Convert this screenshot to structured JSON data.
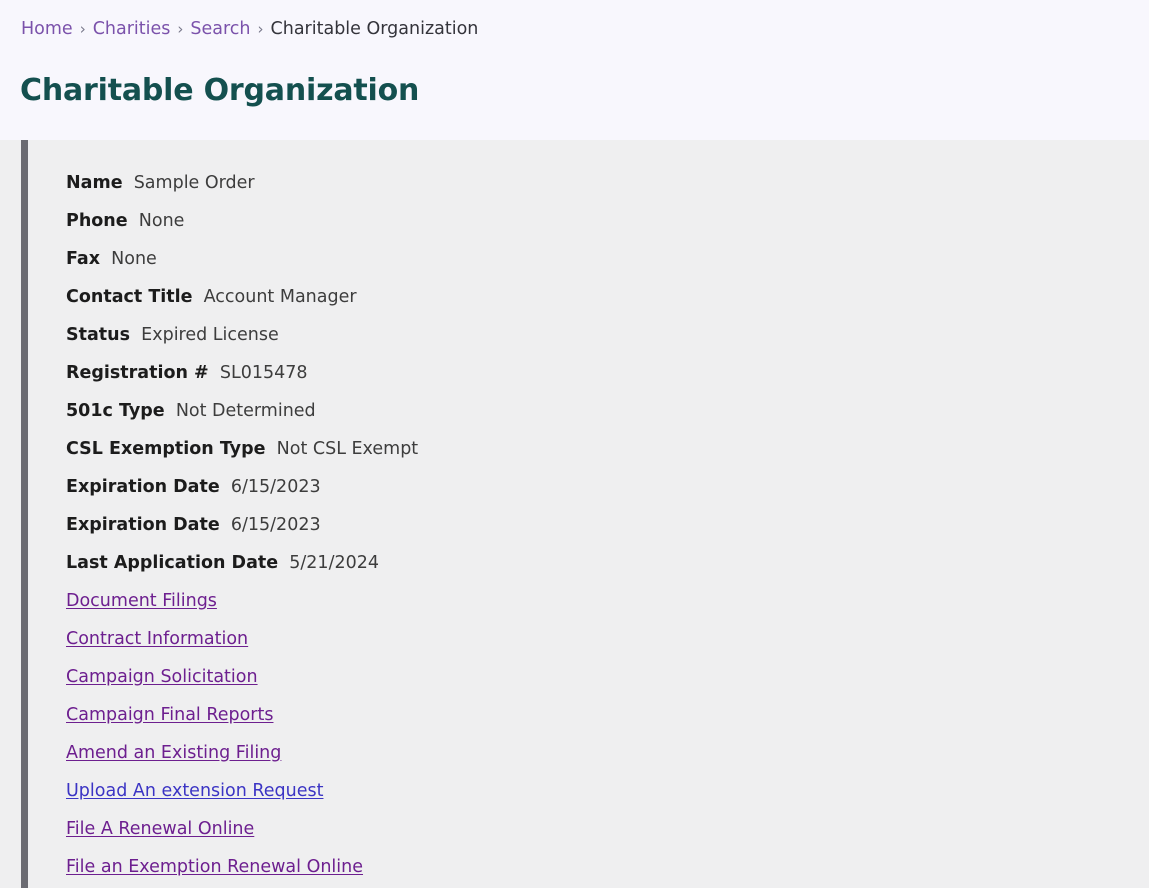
{
  "breadcrumb": {
    "separator": "›",
    "items": [
      {
        "label": "Home",
        "link": true
      },
      {
        "label": "Charities",
        "link": true
      },
      {
        "label": "Search",
        "link": true
      },
      {
        "label": "Charitable Organization",
        "link": false
      }
    ]
  },
  "page": {
    "title": "Charitable Organization"
  },
  "details": {
    "fields": [
      {
        "label": "Name",
        "value": "Sample Order"
      },
      {
        "label": "Phone",
        "value": "None"
      },
      {
        "label": "Fax",
        "value": "None"
      },
      {
        "label": "Contact Title",
        "value": "Account Manager"
      },
      {
        "label": "Status",
        "value": "Expired License"
      },
      {
        "label": "Registration #",
        "value": "SL015478"
      },
      {
        "label": "501c Type",
        "value": "Not Determined"
      },
      {
        "label": "CSL Exemption Type",
        "value": "Not CSL Exempt"
      },
      {
        "label": "Expiration Date",
        "value": "6/15/2023"
      },
      {
        "label": "Expiration Date",
        "value": "6/15/2023"
      },
      {
        "label": "Last Application Date",
        "value": "5/21/2024"
      }
    ],
    "links": [
      {
        "label": "Document Filings",
        "state": "visited",
        "indented": false
      },
      {
        "label": "Contract Information",
        "state": "visited",
        "indented": false
      },
      {
        "label": "Campaign Solicitation",
        "state": "visited",
        "indented": false
      },
      {
        "label": "Campaign Final Reports",
        "state": "visited",
        "indented": false
      },
      {
        "label": "Amend an Existing Filing",
        "state": "visited",
        "indented": false
      },
      {
        "label": "Upload An extension Request",
        "state": "unvisited",
        "indented": false
      },
      {
        "label": " File A Renewal Online",
        "state": "visited",
        "indented": true
      },
      {
        "label": " File an Exemption Renewal Online",
        "state": "visited",
        "indented": true
      }
    ]
  },
  "colors": {
    "page_background": "#f8f7fd",
    "panel_background": "#efeff0",
    "panel_accent": "#6b6b72",
    "title": "#14504f",
    "breadcrumb_link": "#7b52ab",
    "link_visited": "#6d1f8f",
    "link_unvisited": "#3b34c4"
  }
}
